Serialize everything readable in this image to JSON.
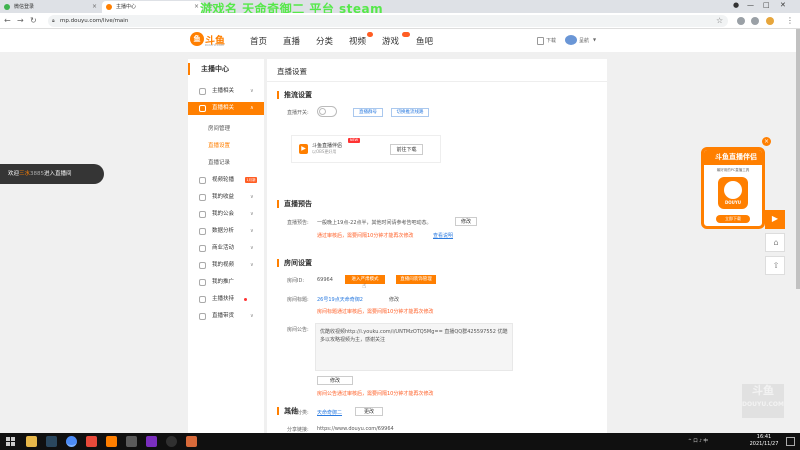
{
  "browser": {
    "tabs": [
      {
        "label": "微信登录"
      },
      {
        "label": "主播中心"
      }
    ],
    "url": "mp.douyu.com/live/main",
    "overlay_title": "游戏名 天命奇御二 平台 steam"
  },
  "site": {
    "logo_text": "斗鱼",
    "logo_sub": "DOUYU.COM",
    "nav": [
      "首页",
      "直播",
      "分类",
      "视频",
      "游戏",
      "鱼吧"
    ],
    "header_right": {
      "download": "下载",
      "user": "呈航"
    }
  },
  "sidebar": {
    "title": "主播中心",
    "items": [
      {
        "label": "主播相关"
      },
      {
        "label": "直播相关"
      },
      {
        "label": "视频轮播"
      },
      {
        "label": "我的收益"
      },
      {
        "label": "我的公会"
      },
      {
        "label": "数据分析"
      },
      {
        "label": "商业活动"
      },
      {
        "label": "我的视频"
      },
      {
        "label": "我的推广"
      },
      {
        "label": "主播扶持"
      },
      {
        "label": "直播带货"
      }
    ],
    "subitems": [
      "房间管理",
      "直播设置",
      "直播记录"
    ],
    "new_badge": "1月新"
  },
  "content": {
    "page_title": "直播设置",
    "push": {
      "title": "推流设置",
      "switch_label": "直播开关:",
      "btn_account": "直播群号",
      "btn_switch_line": "切换推流线路",
      "tool_name": "斗鱼直播伴侣",
      "tool_new": "NEW",
      "tool_desc": "以OBS更好用",
      "download_btn": "前往下载"
    },
    "notice": {
      "title": "直播预告",
      "label": "直播预告:",
      "text": "一般晚上19点-22点半，其他时间请参考告吧动态。",
      "edit_btn": "修改",
      "warning": "通过审核后，需要间隔10分钟才能再次修改",
      "help_link": "查看说明"
    },
    "room": {
      "title": "房间设置",
      "id_label": "房间ID:",
      "id_value": "69964",
      "enter_btn": "进入严肃模式",
      "tips_btn": "直播间装饰管理",
      "name_label": "房间标题:",
      "name_value": "26号19点天命奇御2",
      "name_edit": "修改",
      "name_warning": "房间标题通过审核后，需要间隔10分钟才能再次修改",
      "announce_label": "房间公告:",
      "announce_text": "优酷收视频http://i.youku.com/i/UNTMzOTQ5Mg== 直播QQ群425597552 优酷多以攻略视频为主，感谢关注",
      "announce_edit": "修改",
      "announce_warning": "房间公告通过审核后，需要间隔10分钟才能再次修改",
      "category_label": "房间分类:",
      "category_value": "天命奇御二",
      "category_edit": "更改"
    },
    "other": {
      "title": "其他",
      "share_label": "分享链接:",
      "share_url": "https://www.douyu.com/69964"
    }
  },
  "welcome": {
    "prefix": "欢迎",
    "user": "三水",
    "mid": "3885",
    "suffix": "进入直播间"
  },
  "promo": {
    "title": "斗鱼直播伴侣",
    "subtitle": "最好用的PC直播工具",
    "badge": "DOUYU",
    "button": "立即下载"
  },
  "watermark": {
    "text": "斗鱼",
    "sub": "DOUYU.COM"
  },
  "taskbar": {
    "tray_text": "^ 口 ♪ 中",
    "time": "16:41",
    "date": "2021/11/27"
  },
  "colors": {
    "accent": "#ff7f00",
    "link": "#2b7be0",
    "warning": "#ff5d23",
    "overlay_green": "#56e84a"
  }
}
